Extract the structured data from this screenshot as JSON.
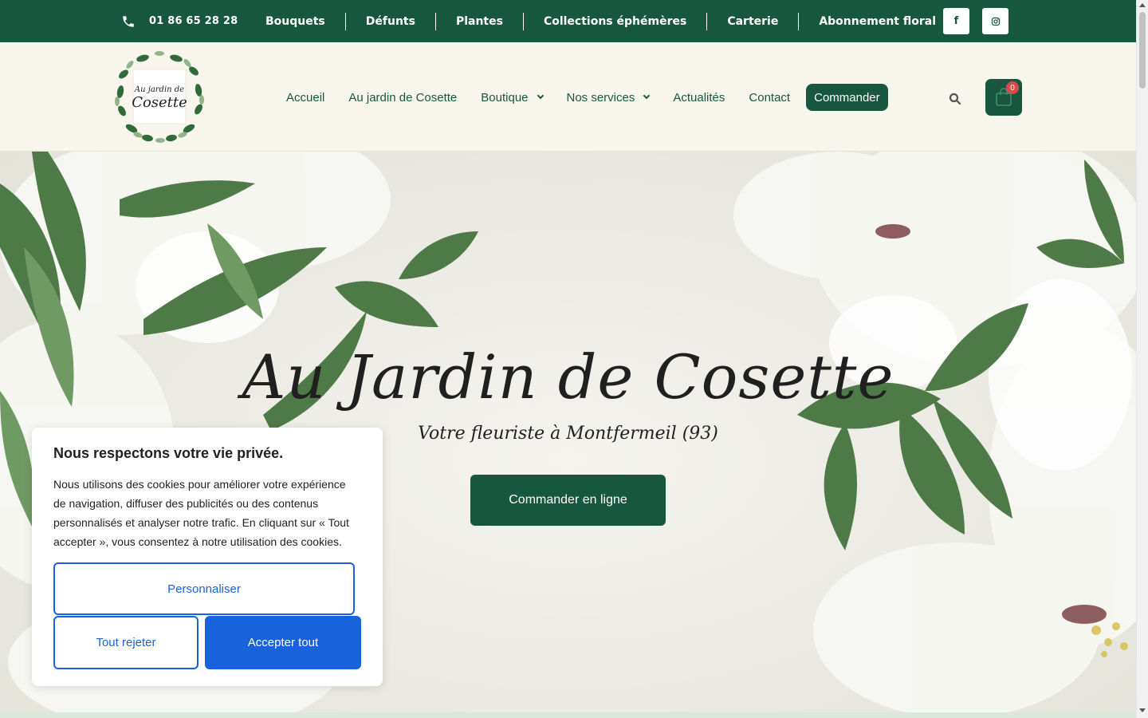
{
  "topbar": {
    "phone": "01 86 65 28 28",
    "links": [
      "Bouquets",
      "Défunts",
      "Plantes",
      "Collections éphémères",
      "Carterie",
      "Abonnement floral"
    ],
    "social": {
      "facebook": "f",
      "instagram_icon": "instagram-icon"
    }
  },
  "header": {
    "logo": {
      "line1": "Au jardin de",
      "line2": "Cosette"
    },
    "nav": {
      "accueil": "Accueil",
      "jardin": "Au jardin de Cosette",
      "boutique": "Boutique",
      "services": "Nos services",
      "actualites": "Actualités",
      "contact": "Contact",
      "commander": "Commander"
    },
    "cart_count": "0"
  },
  "hero": {
    "title": "Au Jardin de Cosette",
    "subtitle": "Votre fleuriste à Montfermeil (93)",
    "button": "Commander en ligne"
  },
  "cookie": {
    "title": "Nous respectons votre vie privée.",
    "text": "Nous utilisons des cookies pour améliorer votre expérience de navigation, diffuser des publicités ou des contenus personnalisés et analyser notre trafic. En cliquant sur « Tout accepter », vous consentez à notre utilisation des cookies.",
    "customize": "Personnaliser",
    "reject": "Tout rejeter",
    "accept": "Accepter tout"
  },
  "colors": {
    "brand_green": "#17573f",
    "cookie_blue": "#1863dc",
    "header_bg": "#f8f5ec",
    "badge_red": "#e0474c"
  }
}
